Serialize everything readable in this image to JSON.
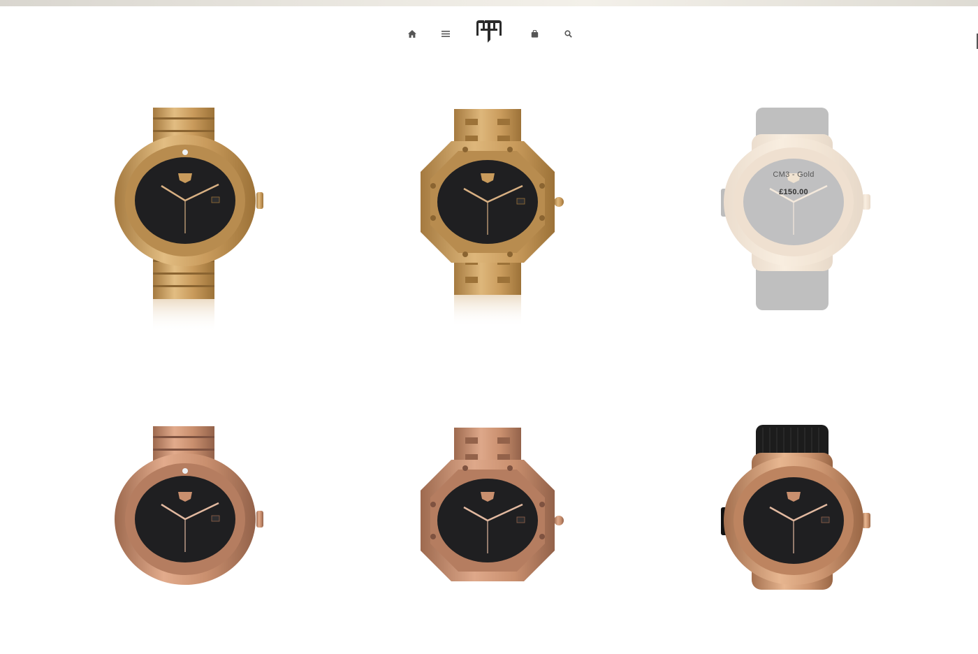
{
  "nav": {
    "items": [
      {
        "icon": "home-icon"
      },
      {
        "icon": "menu-icon"
      },
      {
        "icon": "logo"
      },
      {
        "icon": "shopping-bag-icon"
      },
      {
        "icon": "search-icon"
      }
    ]
  },
  "colors": {
    "gold": "#c9a063",
    "rose_gold": "#c98f6e",
    "dial": "#1f1f21",
    "rubber_strap": "#1c1c1c",
    "icon": "#555555"
  },
  "products": [
    {
      "style": "diver-bracelet",
      "metal": "gold"
    },
    {
      "style": "octagon-bracelet",
      "metal": "gold"
    },
    {
      "style": "rubber-strap",
      "metal": "gold",
      "hovered": true,
      "name": "CM3 - Gold",
      "price": "£150.00"
    },
    {
      "style": "diver-bracelet",
      "metal": "rose_gold"
    },
    {
      "style": "octagon-bracelet",
      "metal": "rose_gold"
    },
    {
      "style": "rubber-strap",
      "metal": "rose_gold"
    }
  ]
}
